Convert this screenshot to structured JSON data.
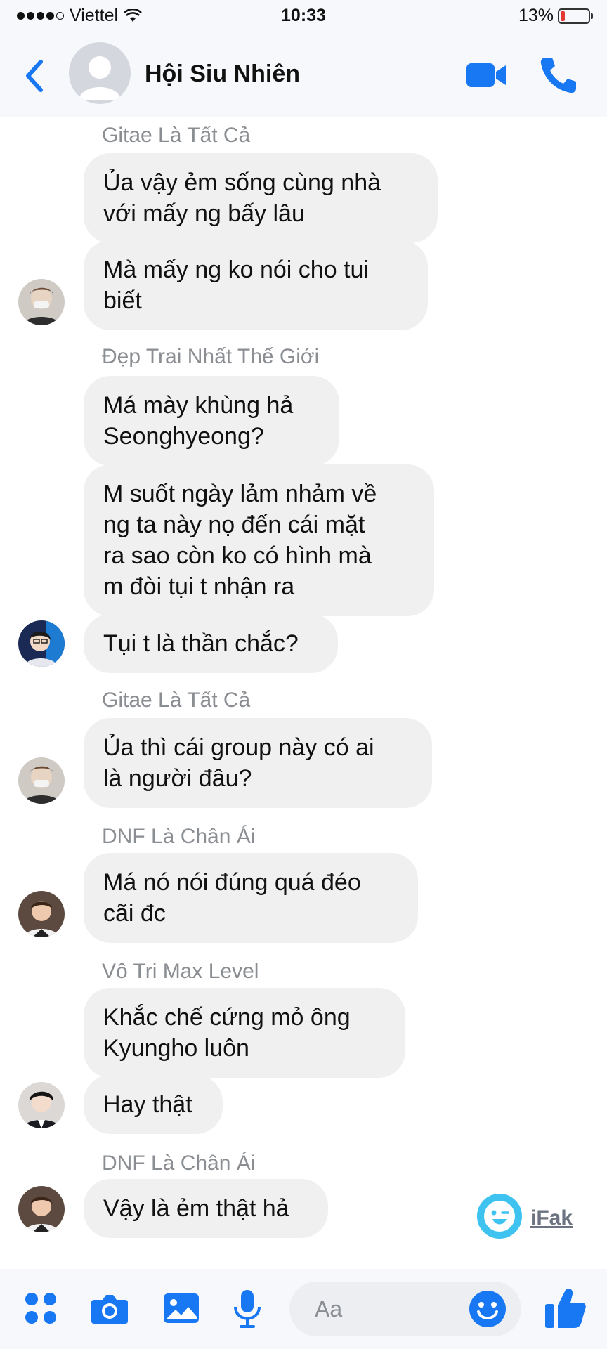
{
  "status_bar": {
    "carrier": "Viettel",
    "time": "10:33",
    "battery": "13%"
  },
  "header": {
    "title": "Hội Siu Nhiên"
  },
  "messages": [
    {
      "sender": "Gitae Là Tất Cả",
      "bubbles": [
        "Ủa vậy ẻm sống cùng nhà\nvới mấy ng bấy lâu",
        "Mà mấy ng ko nói cho tui\nbiết"
      ]
    },
    {
      "sender": "Đẹp Trai Nhất Thế Giới",
      "bubbles": [
        "Má mày khùng hả\nSeonghyeong?",
        "M suốt ngày lảm nhảm về\nng ta này nọ đến cái mặt\nra sao còn ko có hình mà\nm đòi tụi t nhận ra",
        "Tụi t là thần chắc?"
      ]
    },
    {
      "sender": "Gitae Là Tất Cả",
      "bubbles": [
        "Ủa thì cái group này có ai\nlà người đâu?"
      ]
    },
    {
      "sender": "DNF Là Chân Ái",
      "bubbles": [
        "Má nó nói đúng quá đéo\ncãi đc"
      ]
    },
    {
      "sender": "Vô Tri Max Level",
      "bubbles": [
        "Khắc chế cứng mỏ ông\nKyungho luôn",
        "Hay thật"
      ]
    },
    {
      "sender": "DNF Là Chân Ái",
      "bubbles": [
        "Vậy là ẻm thật hả"
      ]
    }
  ],
  "watermark": {
    "text": "iFak"
  },
  "composer": {
    "placeholder": "Aa"
  },
  "colors": {
    "accent": "#1877f2",
    "bubble": "#f0f0f0",
    "sender": "#8a8d91"
  }
}
